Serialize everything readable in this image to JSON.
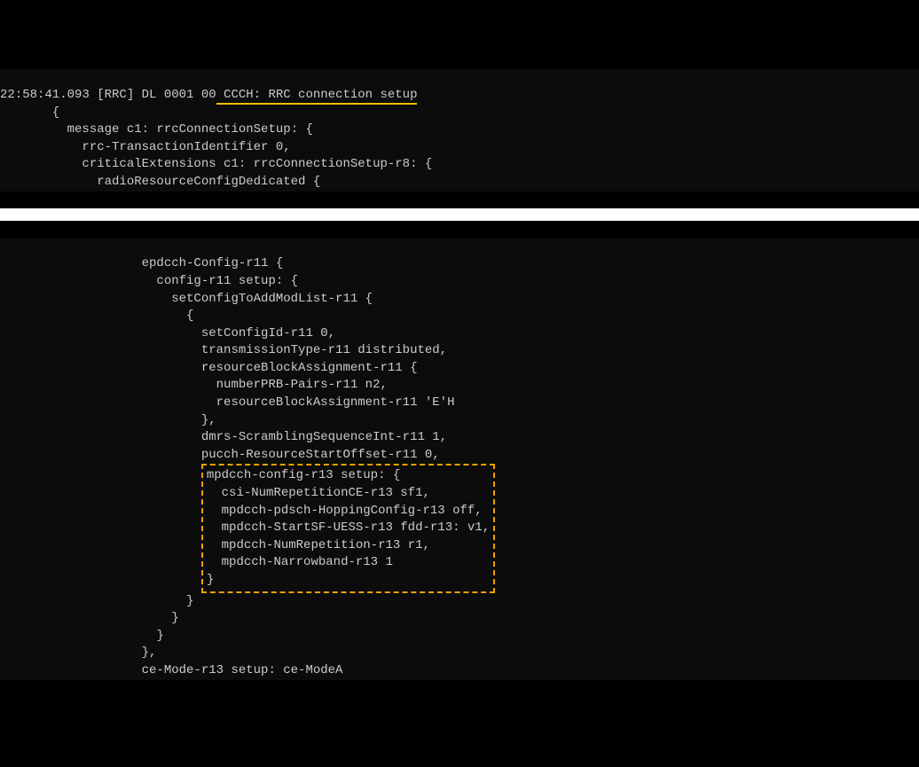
{
  "header": {
    "prefix": "22:58:41.093 [RRC] DL 0001 00",
    "highlighted": " CCCH: RRC connection setup"
  },
  "block1": {
    "l1": "       {",
    "l2": "         message c1: rrcConnectionSetup: {",
    "l3": "           rrc-TransactionIdentifier 0,",
    "l4": "           criticalExtensions c1: rrcConnectionSetup-r8: {",
    "l5": "             radioResourceConfigDedicated {"
  },
  "block2": {
    "l1": "                   epdcch-Config-r11 {",
    "l2": "                     config-r11 setup: {",
    "l3": "                       setConfigToAddModList-r11 {",
    "l4": "                         {",
    "l5": "                           setConfigId-r11 0,",
    "l6": "                           transmissionType-r11 distributed,",
    "l7": "                           resourceBlockAssignment-r11 {",
    "l8": "                             numberPRB-Pairs-r11 n2,",
    "l9": "                             resourceBlockAssignment-r11 'E'H",
    "l10": "                           },",
    "l11": "                           dmrs-ScramblingSequenceInt-r11 1,",
    "l12": "                           pucch-ResourceStartOffset-r11 0,",
    "boxed": {
      "l1": "mpdcch-config-r13 setup: {",
      "l2": "  csi-NumRepetitionCE-r13 sf1,",
      "l3": "  mpdcch-pdsch-HoppingConfig-r13 off,",
      "l4": "  mpdcch-StartSF-UESS-r13 fdd-r13: v1,",
      "l5": "  mpdcch-NumRepetition-r13 r1,",
      "l6": "  mpdcch-Narrowband-r13 1",
      "l7": "}"
    },
    "boxIndent": "                           ",
    "l14": "                         }",
    "l15": "                       }",
    "l16": "                     }",
    "l17": "                   },",
    "l18": "                   ce-Mode-r13 setup: ce-ModeA"
  }
}
